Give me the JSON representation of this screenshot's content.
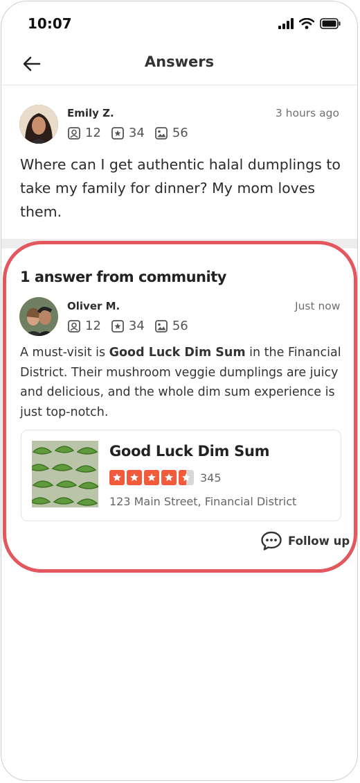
{
  "status_bar": {
    "time": "10:07"
  },
  "header": {
    "title": "Answers"
  },
  "question": {
    "author": "Emily Z.",
    "timestamp": "3 hours ago",
    "stats": {
      "friends": "12",
      "reviews": "34",
      "photos": "56"
    },
    "text": "Where can I get authentic halal dumplings to take my family for dinner? My mom loves them."
  },
  "answers": {
    "heading": "1 answer from community",
    "items": [
      {
        "author": "Oliver M.",
        "timestamp": "Just now",
        "stats": {
          "friends": "12",
          "reviews": "34",
          "photos": "56"
        },
        "text_before": "A must-visit is ",
        "text_bold": "Good Luck Dim Sum",
        "text_after": " in the Financial District. Their mushroom veggie dumplings are juicy and delicious, and the whole dim sum experience is just top-notch.",
        "business": {
          "name": "Good Luck Dim Sum",
          "rating": 4.5,
          "review_count": "345",
          "address": "123 Main Street, Financial District"
        },
        "follow_up_label": "Follow up"
      }
    ]
  },
  "colors": {
    "accent": "#e3575e",
    "star": "#f15a3b"
  }
}
